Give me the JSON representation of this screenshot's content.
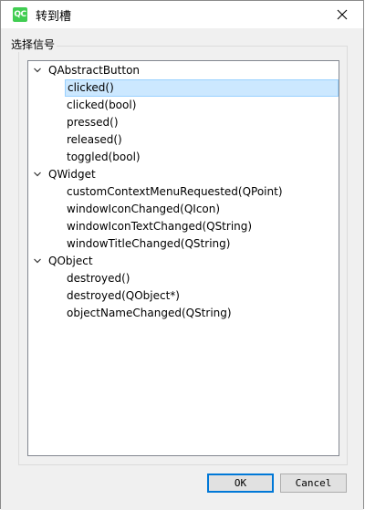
{
  "window": {
    "title": "转到槽",
    "app_icon_text": "QC"
  },
  "group": {
    "title": "选择信号"
  },
  "tree": [
    {
      "label": "QAbstractButton",
      "level": 0,
      "expanded": true
    },
    {
      "label": "clicked()",
      "level": 1,
      "selected": true
    },
    {
      "label": "clicked(bool)",
      "level": 1
    },
    {
      "label": "pressed()",
      "level": 1
    },
    {
      "label": "released()",
      "level": 1
    },
    {
      "label": "toggled(bool)",
      "level": 1
    },
    {
      "label": "QWidget",
      "level": 0,
      "expanded": true
    },
    {
      "label": "customContextMenuRequested(QPoint)",
      "level": 1
    },
    {
      "label": "windowIconChanged(QIcon)",
      "level": 1
    },
    {
      "label": "windowIconTextChanged(QString)",
      "level": 1
    },
    {
      "label": "windowTitleChanged(QString)",
      "level": 1
    },
    {
      "label": "QObject",
      "level": 0,
      "expanded": true
    },
    {
      "label": "destroyed()",
      "level": 1
    },
    {
      "label": "destroyed(QObject*)",
      "level": 1
    },
    {
      "label": "objectNameChanged(QString)",
      "level": 1
    }
  ],
  "buttons": {
    "ok": "OK",
    "cancel": "Cancel"
  },
  "colors": {
    "selection_bg": "#cce8ff",
    "selection_border": "#99d1ff",
    "default_button_border": "#0078d7",
    "qt_green": "#41cd52"
  }
}
